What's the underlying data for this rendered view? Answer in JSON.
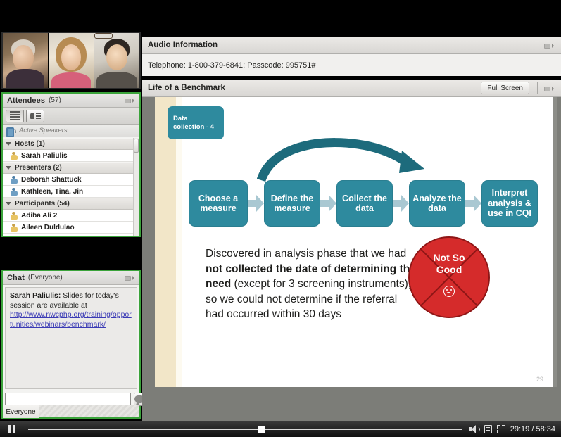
{
  "webcam": {
    "cameras": [
      "camera-thumbnail-1",
      "camera-thumbnail-2",
      "camera-thumbnail-3"
    ]
  },
  "attendees": {
    "title": "Attendees",
    "count_label": "(57)",
    "toolbar": {
      "list_view": "list-view-icon",
      "card_view": "card-view-icon"
    },
    "active_speakers_label": "Active Speakers",
    "groups": [
      {
        "label": "Hosts (1)",
        "members": [
          {
            "name": "Sarah Paliulis",
            "role": "host"
          }
        ]
      },
      {
        "label": "Presenters (2)",
        "members": [
          {
            "name": "Deborah Shattuck",
            "role": "presenter"
          },
          {
            "name": "Kathleen, Tina, Jin",
            "role": "presenter"
          }
        ]
      },
      {
        "label": "Participants (54)",
        "members": [
          {
            "name": "Adiba Ali 2",
            "role": "participant"
          },
          {
            "name": "Aileen Duldulao",
            "role": "participant"
          }
        ]
      }
    ]
  },
  "chat": {
    "title": "Chat",
    "scope_label": "(Everyone)",
    "message_author": "Sarah Paliulis:",
    "message_text": " Slides for today's session are available at",
    "message_link": "http://www.nwcphp.org/training/opportunities/webinars/benchmark/",
    "input_placeholder": "",
    "input_value": "",
    "send_icon": "chat-bubble-icon",
    "tab_label": "Everyone"
  },
  "audio_pod": {
    "title": "Audio Information",
    "info": "Telephone: 1-800-379-6841; Passcode: 995751#"
  },
  "share_pod": {
    "title": "Life of a Benchmark",
    "full_screen_label": "Full Screen"
  },
  "slide": {
    "tag_line1": "Data",
    "tag_line2": "collection - 4",
    "flow_steps": [
      "Choose a measure",
      "Define the measure",
      "Collect the data",
      "Analyze the data",
      "Interpret analysis & use in CQI"
    ],
    "body_parts": [
      {
        "text": "Discovered in analysis phase that we had ",
        "bold": false
      },
      {
        "text": "not collected the date of determining the need",
        "bold": true
      },
      {
        "text": " (except for 3 screening instruments), so we could not determine if the referral had occurred within 30 days",
        "bold": false
      }
    ],
    "badge_line1": "Not So",
    "badge_line2": "Good",
    "badge_icon": "sad-face-icon",
    "page_number": "29"
  },
  "player": {
    "play_state_icon": "pause-icon",
    "volume_icon": "volume-icon",
    "captions_icon": "captions-icon",
    "fullscreen_icon": "fullscreen-icon",
    "current_time": "29:19",
    "separator": "/",
    "total_time": "58:34",
    "time_display": "29:19 / 58:34",
    "progress_percent": 50
  },
  "colors": {
    "teal": "#2e8a9e",
    "dark_teal": "#1d6b7c",
    "arrow_blue": "#a9c8d2",
    "badge_red": "#d52b2b",
    "pod_border_green": "#3aa33a",
    "slide_band": "#f2e6c8"
  }
}
